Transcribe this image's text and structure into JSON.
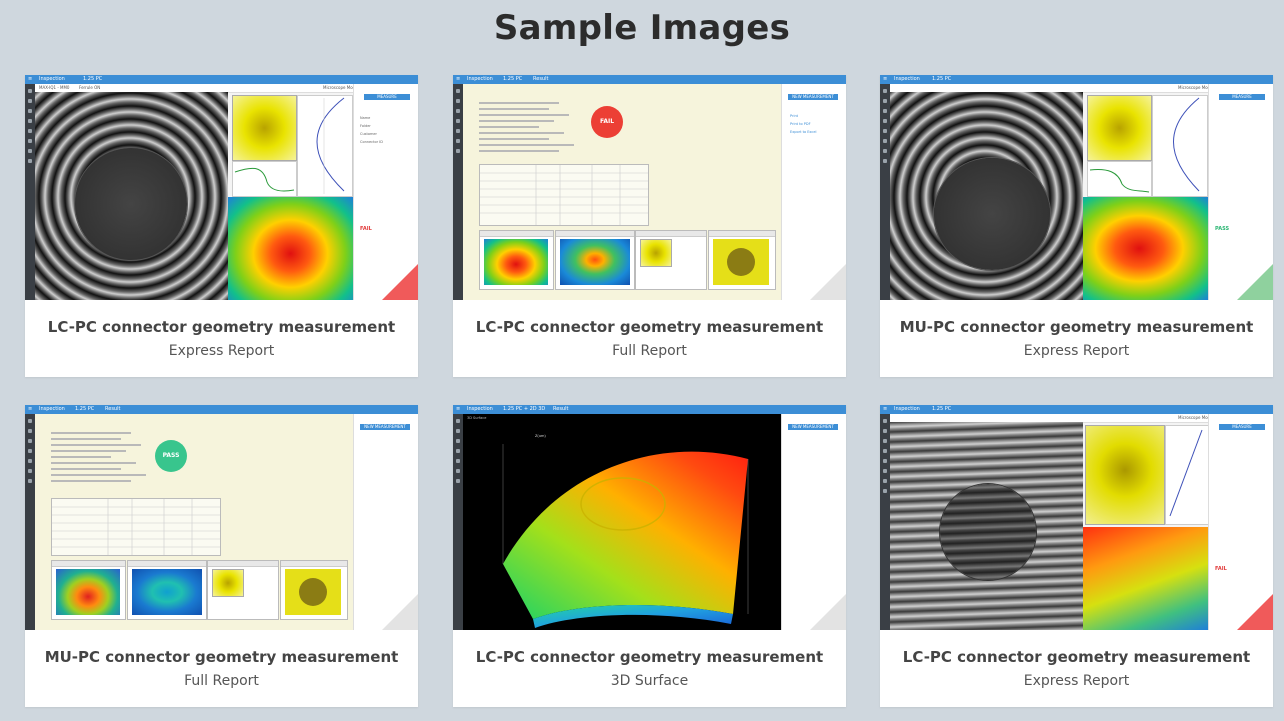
{
  "page": {
    "title": "Sample Images"
  },
  "cards": [
    {
      "caption": "LC-PC connector geometry measurement",
      "subcaption": "Express Report",
      "app": {
        "tab": "Inspection",
        "ferrule": "1.25 PC",
        "device": "MAX-IQ1 - MM0",
        "sub": "Ferrule ON",
        "mode": "Microscope Mode",
        "button": "MEASURE",
        "rows": [
          "Name",
          "Folder",
          "Customer",
          "Connector ID"
        ],
        "verdict": "FAIL",
        "verdict_color": "#e23b3b"
      }
    },
    {
      "caption": "LC-PC connector geometry measurement",
      "subcaption": "Full Report",
      "app": {
        "tab": "Inspection",
        "ferrule": "1.25 PC",
        "crumb": "Result",
        "button": "NEW MEASUREMENT",
        "verdict": "FAIL",
        "verdict_color": "#ec3f35",
        "links": [
          "Print",
          "Print to PDF",
          "Export to Excel"
        ]
      }
    },
    {
      "caption": "MU-PC connector geometry measurement",
      "subcaption": "Express Report",
      "app": {
        "tab": "Inspection",
        "ferrule": "1.25 PC",
        "mode": "Microscope Mode",
        "button": "MEASURE",
        "verdict": "PASS",
        "verdict_color": "#2bb673"
      }
    },
    {
      "caption": "MU-PC connector geometry measurement",
      "subcaption": "Full Report",
      "app": {
        "tab": "Inspection",
        "ferrule": "1.25 PC",
        "crumb": "Result",
        "button": "NEW MEASUREMENT",
        "verdict": "PASS",
        "verdict_color": "#38c58d"
      }
    },
    {
      "caption": "LC-PC connector geometry measurement",
      "subcaption": "3D Surface",
      "app": {
        "tab": "Inspection",
        "ferrule": "1.25 PC + 2D 3D",
        "crumb": "Result",
        "button": "NEW MEASUREMENT",
        "view": "3D Surface",
        "axis_label": "Z(um)"
      }
    },
    {
      "caption": "LC-PC connector geometry measurement",
      "subcaption": "Express Report",
      "app": {
        "tab": "Inspection",
        "ferrule": "1.25 PC",
        "mode": "Microscope Mode",
        "button": "MEASURE",
        "verdict": "FAIL",
        "verdict_color": "#e23b3b"
      }
    }
  ],
  "colors": {
    "background": "#cfd7de",
    "accent_blue": "#3c8ed6",
    "fail_red": "#f05a5a",
    "pass_green": "#8fd19e"
  }
}
